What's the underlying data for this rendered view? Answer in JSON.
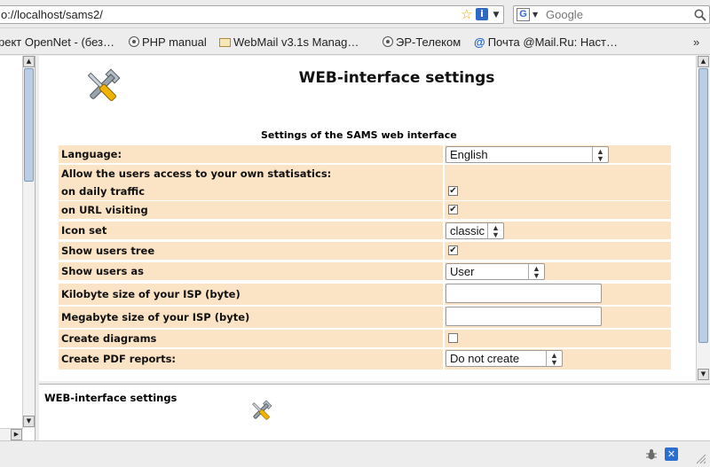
{
  "browser": {
    "url": "o://localhost/sams2/",
    "search_placeholder": "Google",
    "search_engine_letter": "G",
    "bookmarks": [
      {
        "label": "рект OpenNet - (без…",
        "icon": "none"
      },
      {
        "label": "PHP manual",
        "icon": "page-icon"
      },
      {
        "label": "WebMail v3.1s Manag…",
        "icon": "mail-icon"
      },
      {
        "label": "ЭР-Телеком",
        "icon": "page-icon"
      },
      {
        "label": "Почта @Mail.Ru: Наст…",
        "icon": "at-icon"
      }
    ],
    "overflow_chevron": "»"
  },
  "main": {
    "title": "WEB-interface settings",
    "caption": "Settings of the SAMS web interface",
    "rows": [
      {
        "label": "Language:",
        "control": "select",
        "value": "English"
      },
      {
        "label": "Allow the users access to your own statisatics:",
        "control": "none"
      },
      {
        "label": "on daily traffic",
        "control": "checkbox",
        "checked": true
      },
      {
        "label": "on URL visiting",
        "control": "checkbox",
        "checked": true
      },
      {
        "label": "Icon set",
        "control": "select",
        "value": "classic"
      },
      {
        "label": "Show users tree",
        "control": "checkbox",
        "checked": true
      },
      {
        "label": "Show users as",
        "control": "select",
        "value": "User"
      },
      {
        "label": "Kilobyte size of your ISP (byte)",
        "control": "text",
        "value": ""
      },
      {
        "label": "Megabyte size of your ISP (byte)",
        "control": "text",
        "value": ""
      },
      {
        "label": "Create diagrams",
        "control": "checkbox",
        "checked": false
      },
      {
        "label": "Create PDF reports:",
        "control": "select",
        "value": "Do not create"
      }
    ],
    "row_bg": "#fbe3c5"
  },
  "bottom": {
    "title": "WEB-interface settings"
  },
  "icons": {
    "settings": "tools-icon",
    "star": "star-icon",
    "info": "info-icon",
    "search": "search-icon",
    "status_bug": "bug-icon",
    "status_x": "x-icon"
  }
}
